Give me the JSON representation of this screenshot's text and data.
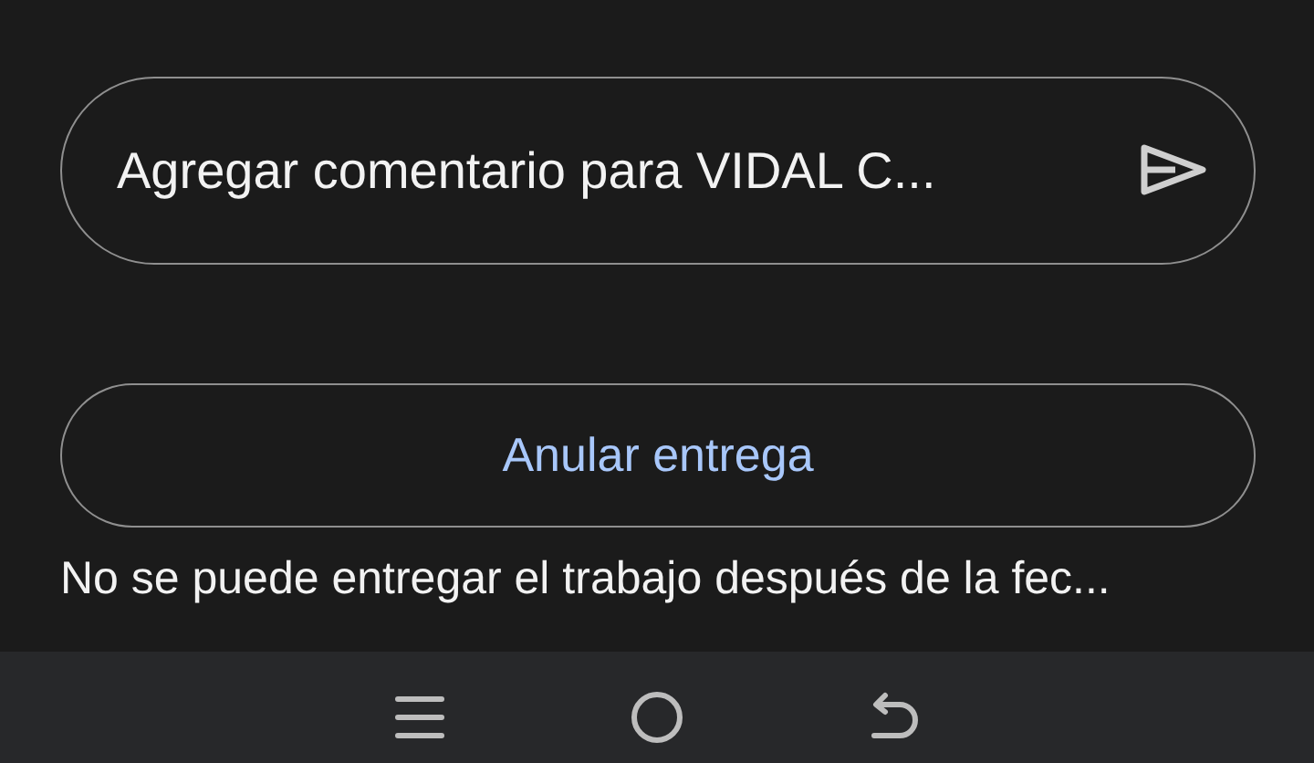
{
  "comment_field": {
    "placeholder": "Agregar comentario para VIDAL C..."
  },
  "unsubmit_button": {
    "label": "Anular entrega"
  },
  "note": "No se puede entregar el trabajo después de la fec...",
  "nav_bar": {
    "buttons": [
      {
        "kind": "menu"
      },
      {
        "kind": "home"
      },
      {
        "kind": "back"
      }
    ]
  }
}
